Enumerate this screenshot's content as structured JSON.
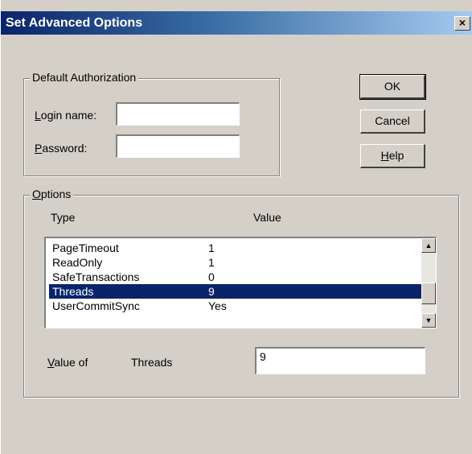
{
  "window": {
    "title": "Set Advanced Options",
    "close_glyph": "×"
  },
  "auth_group": {
    "legend": "Default Authorization",
    "login_label_hotkey": "L",
    "login_label_rest": "ogin name:",
    "login_value": "",
    "password_label_hotkey": "P",
    "password_label_rest": "assword:",
    "password_value": ""
  },
  "buttons": {
    "ok": "OK",
    "cancel": "Cancel",
    "help_hotkey": "H",
    "help_rest": "elp"
  },
  "options_group": {
    "legend_hotkey": "O",
    "legend_rest": "ptions",
    "col_type": "Type",
    "col_value": "Value",
    "rows": [
      {
        "type": "PageTimeout",
        "value": "1"
      },
      {
        "type": "ReadOnly",
        "value": "1"
      },
      {
        "type": "SafeTransactions",
        "value": "0"
      },
      {
        "type": "Threads",
        "value": "9"
      },
      {
        "type": "UserCommitSync",
        "value": "Yes"
      }
    ],
    "selected_index": 3,
    "value_of_hotkey": "V",
    "value_of_rest": "alue of",
    "value_of_name": "Threads",
    "value_of_value": "9"
  },
  "icons": {
    "scroll_up": "up-arrow-icon",
    "scroll_down": "down-arrow-icon"
  }
}
